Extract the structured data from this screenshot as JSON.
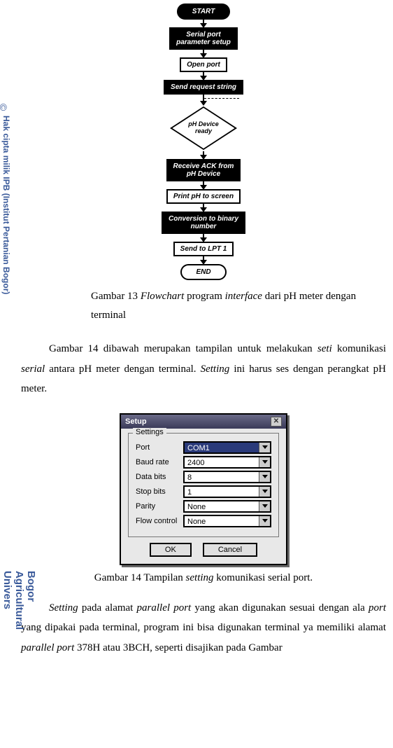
{
  "watermark": {
    "copyright_symbol": "©",
    "line1": "Hak cipta milik IPB (Institut Pertanian Bogor)",
    "line2": "Bogor Agricultural Univers"
  },
  "flowchart": {
    "start": "START",
    "step1": "Serial port\nparameter setup",
    "step2": "Open port",
    "step3": "Send request string",
    "decision": "pH Device\nready",
    "step4": "Receive ACK from\npH Device",
    "step5": "Print pH to screen",
    "step6": "Conversion to binary\nnumber",
    "step7": "Send to LPT 1",
    "end": "END"
  },
  "caption_fig13_pre": "Gambar 13  ",
  "caption_fig13_italic1": "Flowchart",
  "caption_fig13_mid": " program ",
  "caption_fig13_italic2": "interface",
  "caption_fig13_post": " dari pH meter dengan terminal",
  "para1_a": "Gambar 14 dibawah merupakan tampilan untuk melakukan ",
  "para1_i1": "seti",
  "para1_b": " komunikasi ",
  "para1_i2": "serial",
  "para1_c": " antara pH meter dengan terminal. ",
  "para1_i3": "Setting",
  "para1_d": " ini harus ses dengan perangkat pH meter.",
  "dialog": {
    "title": "Setup",
    "group": "Settings",
    "rows": {
      "port": {
        "label": "Port",
        "value": "COM1"
      },
      "baud": {
        "label": "Baud rate",
        "value": "2400"
      },
      "databits": {
        "label": "Data bits",
        "value": "8"
      },
      "stopbits": {
        "label": "Stop bits",
        "value": "1"
      },
      "parity": {
        "label": "Parity",
        "value": "None"
      },
      "flow": {
        "label": "Flow control",
        "value": "None"
      }
    },
    "ok": "OK",
    "cancel": "Cancel"
  },
  "caption_fig14_pre": "Gambar 14 Tampilan ",
  "caption_fig14_italic": "setting",
  "caption_fig14_post": " komunikasi serial port.",
  "para2_i1": "Setting",
  "para2_a": " pada alamat ",
  "para2_i2": "parallel port",
  "para2_b": " yang akan digunakan sesuai dengan ala ",
  "para2_i3": "port",
  "para2_c": " yang dipakai pada terminal, program ini bisa digunakan terminal ya memiliki alamat ",
  "para2_i4": "parallel port",
  "para2_d": " 378H atau 3BCH, seperti disajikan pada Gambar "
}
